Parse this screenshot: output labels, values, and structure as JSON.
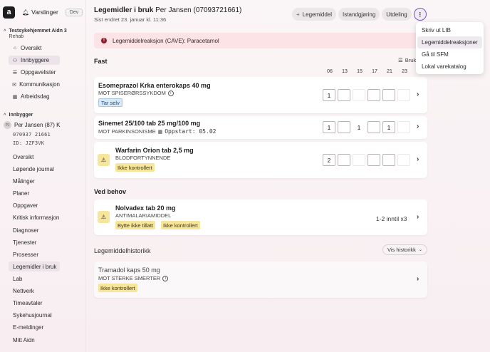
{
  "topbar": {
    "logo_letter": "a",
    "alerts_label": "Varslinger",
    "env_badge": "Dev"
  },
  "sidebar": {
    "unit_name": "Testsykehjemmet Aidn 3",
    "unit_sub": "Rehab",
    "unit_items": [
      {
        "label": "Oversikt",
        "icon": "home-icon"
      },
      {
        "label": "Innbyggere",
        "icon": "people-icon"
      },
      {
        "label": "Oppgavelister",
        "icon": "list-icon"
      },
      {
        "label": "Kommunikasjon",
        "icon": "message-icon"
      },
      {
        "label": "Arbeidsdag",
        "icon": "building-icon"
      }
    ],
    "patient_section": "Innbygger",
    "patient_initials": "PJ",
    "patient_name": "Per Jansen (87) K",
    "patient_id": "070937 21661",
    "patient_ref": "ID: JZF3VK",
    "patient_items": [
      "Oversikt",
      "Løpende journal",
      "Målinger",
      "Planer",
      "Oppgaver",
      "Kritisk informasjon",
      "Diagnoser",
      "Tjenester",
      "Prosesser",
      "Legemidler i bruk",
      "Lab",
      "Nettverk",
      "Timeavtaler",
      "Sykehusjournal",
      "E-meldinger",
      "Mitt Aidn"
    ],
    "active_patient_item": "Legemidler i bruk"
  },
  "header": {
    "title": "Legemidler i bruk",
    "patient": "Per Jansen (07093721661)",
    "last_changed": "Sist endret 23. januar kl. 11:36",
    "buttons": {
      "add": "Legemiddel",
      "reconcile": "Istandgjøring",
      "dispense": "Utdeling",
      "more": "⋮"
    }
  },
  "menu": {
    "items": [
      "Skriv ut LIB",
      "Legemiddelreaksjoner",
      "Gå til SFM",
      "Lokal varekatalog"
    ],
    "hovered": "Legemiddelreaksjoner"
  },
  "cave_alert": "Legemiddelreaksjon (CAVE): Paracetamol",
  "fast": {
    "heading": "Fast",
    "sort_label": "Bruk",
    "times": [
      "06",
      "13",
      "15",
      "17",
      "21",
      "23"
    ],
    "meds": [
      {
        "name": "Esomeprazol Krka enterokaps 40 mg",
        "sub": "MOT SPISERØRSSYKDOM",
        "info": true,
        "tags": [
          "Tar selv"
        ],
        "doses": [
          "1",
          "",
          "",
          "",
          "",
          ""
        ]
      },
      {
        "name": "Sinemet 25/100 tab 25 mg/100 mg",
        "sub": "MOT PARKINSONISME",
        "start": "Oppstart: 05.02",
        "tags": [],
        "doses": [
          "1",
          "",
          "1",
          "",
          "1",
          ""
        ]
      },
      {
        "name": "Warfarin Orion tab 2,5 mg",
        "sub": "BLODFORTYNNENDE",
        "warning": true,
        "tags": [
          "Ikke kontrollert"
        ],
        "doses": [
          "2",
          "",
          "",
          "",
          "",
          ""
        ]
      }
    ]
  },
  "as_needed": {
    "heading": "Ved behov",
    "meds": [
      {
        "name": "Nolvadex tab 20 mg",
        "sub": "ANTIMALARIAMIDDEL",
        "warning": true,
        "tags": [
          "Bytte ikke tillatt",
          "Ikke kontrollert"
        ],
        "dosage": "1-2 inntil x3"
      }
    ]
  },
  "history": {
    "heading": "Legemiddelhistorikk",
    "show_button": "Vis historikk",
    "meds": [
      {
        "name": "Tramadol kaps 50 mg",
        "sub": "MOT STERKE SMERTER",
        "info": true,
        "tags": [
          "Ikke kontrollert"
        ]
      }
    ]
  },
  "colors": {
    "accent": "#7e56c2",
    "cave_bg": "#fbe3e6",
    "tag_yellow": "#f6e59a",
    "tag_blue": "#d9e8f5"
  }
}
